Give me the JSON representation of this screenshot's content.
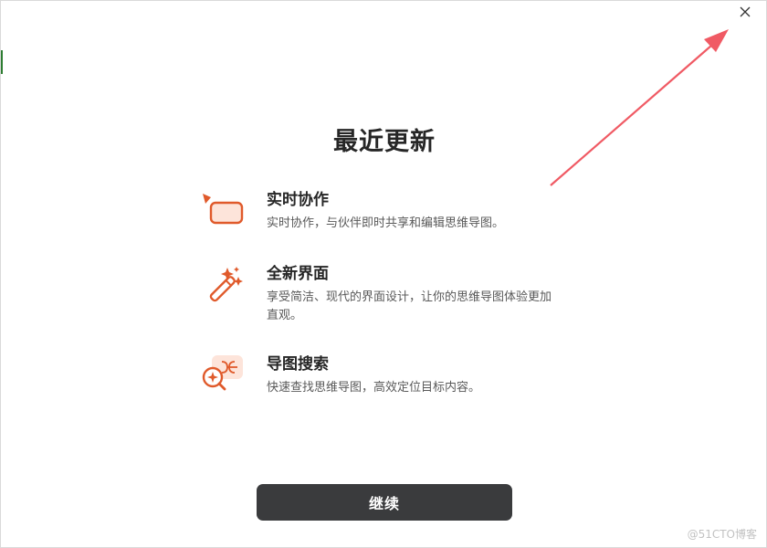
{
  "dialog": {
    "title": "最近更新",
    "features": [
      {
        "icon": "collaboration-icon",
        "name": "实时协作",
        "description": "实时协作，与伙伴即时共享和编辑思维导图。"
      },
      {
        "icon": "magic-wand-icon",
        "name": "全新界面",
        "description": "享受简洁、现代的界面设计，让你的思维导图体验更加直观。"
      },
      {
        "icon": "map-search-icon",
        "name": "导图搜索",
        "description": "快速查找思维导图，高效定位目标内容。"
      }
    ],
    "continue_label": "继续",
    "close_icon": "close-icon"
  },
  "watermark": "@51CTO博客",
  "colors": {
    "accent": "#e05a2b",
    "accent_light": "#fde4da",
    "button_bg": "#3a3b3d",
    "annotation_arrow": "#f05a64"
  }
}
